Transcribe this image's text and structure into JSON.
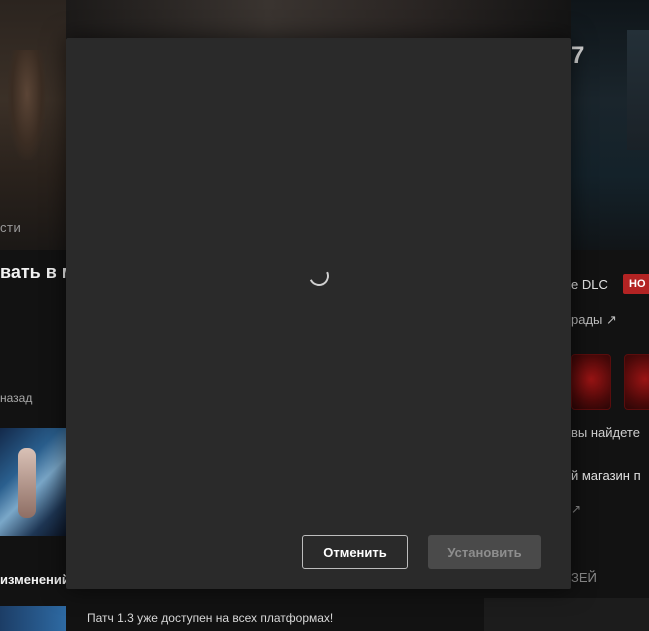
{
  "background": {
    "left": {
      "section_label": "сти",
      "headline": "вать в м",
      "back_label": "назад",
      "changes_label": "изменений"
    },
    "bottom_news": "Патч 1.3 уже доступен на всех платформах!",
    "right": {
      "version": "7",
      "dlc_label": "е DLC",
      "badge": "НО",
      "rewards_label": "рады ↗",
      "find_text": "вы найдете",
      "shop_text": "й магазин п",
      "arrow": "↗",
      "museum_label": "ЗЕЙ"
    }
  },
  "modal": {
    "loading": true,
    "cancel_label": "Отменить",
    "install_label": "Установить",
    "install_disabled": true
  },
  "colors": {
    "modal_bg": "#2a2a2a",
    "badge_red": "#b32323",
    "install_disabled_bg": "#4a4a4a"
  }
}
